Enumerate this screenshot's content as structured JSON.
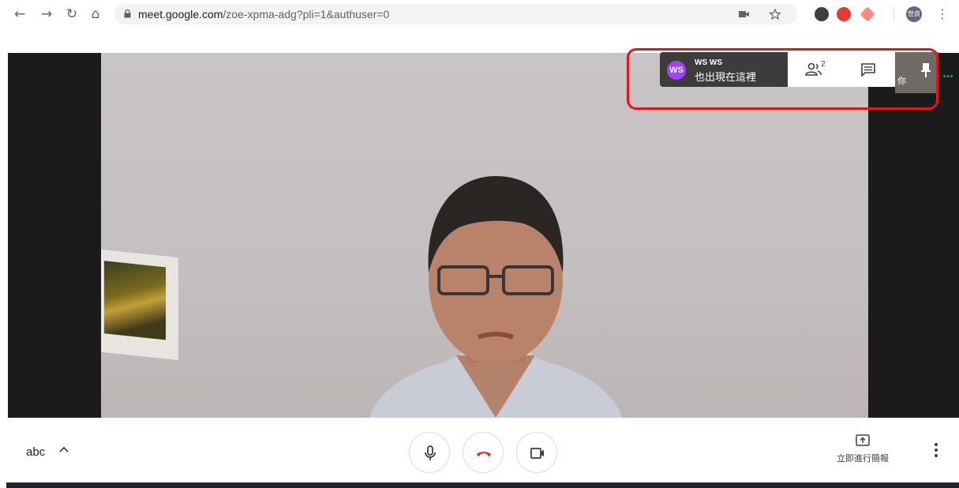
{
  "browser": {
    "url_host": "meet.google.com",
    "url_path": "/zoe-xpma-adg?pli=1&authuser=0",
    "profile_initials": "世良"
  },
  "meeting": {
    "notification": {
      "avatar_initials": "WS",
      "name": "WS WS",
      "message": "也出現在這裡"
    },
    "participants_count": "2",
    "self_label": "你"
  },
  "bottom_bar": {
    "meeting_code": "abc",
    "present_label": "立即進行簡報"
  },
  "colors": {
    "end_call": "#d93025",
    "avatar": "#a142f4",
    "highlight": "#e0161b"
  }
}
